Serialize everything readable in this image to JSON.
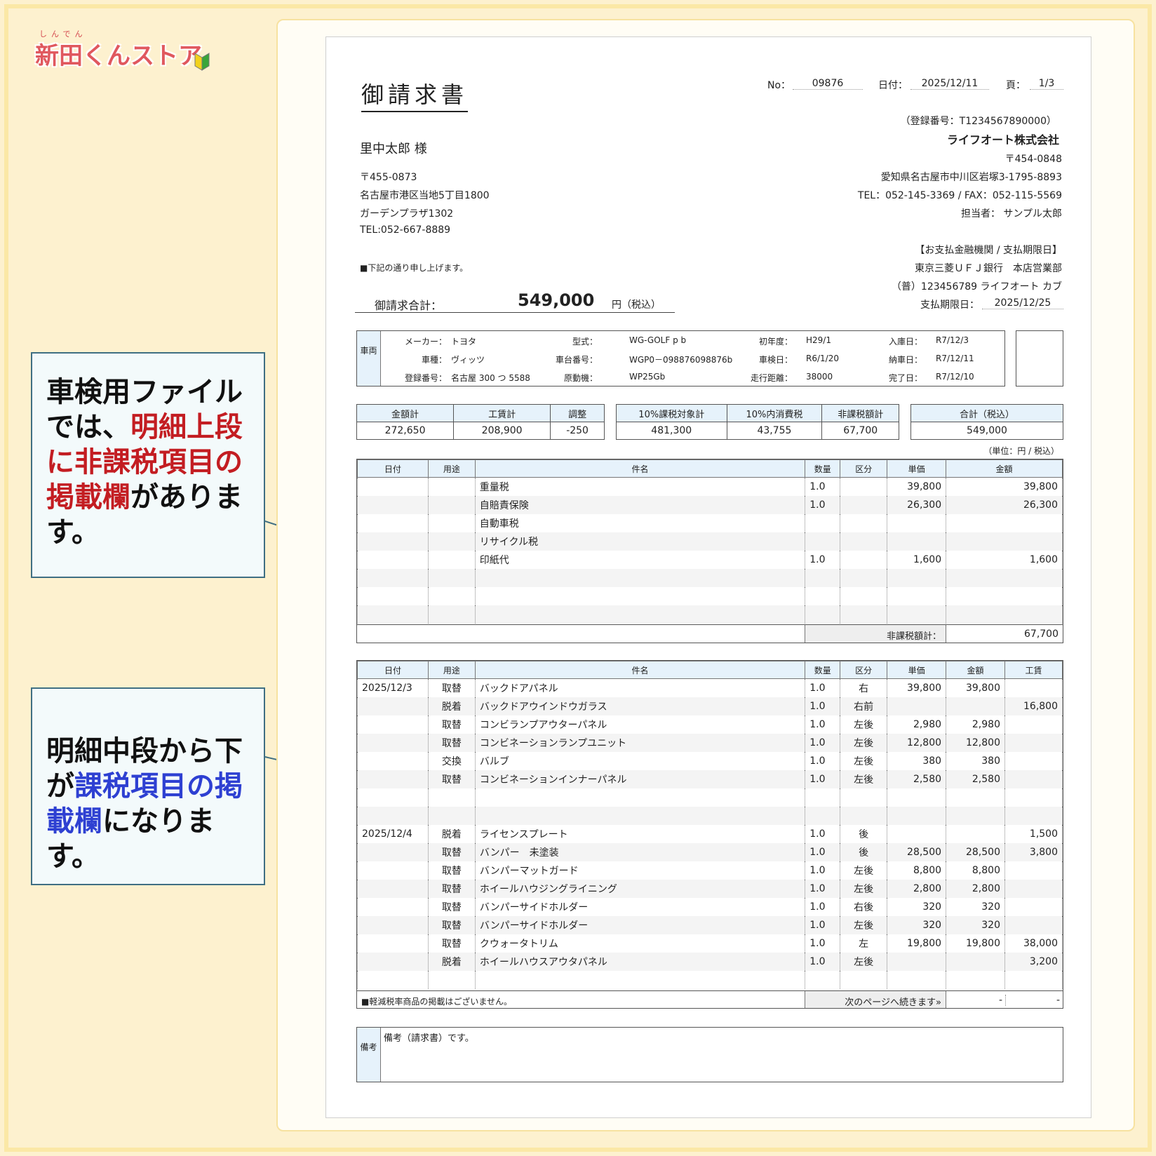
{
  "logo": {
    "ruby": "しんでん",
    "text": "新田くんストア"
  },
  "callouts": {
    "top": {
      "pre": "車検用ファイルでは、",
      "hl": "明細上段に非課税項目の掲載欄",
      "post": "があります。"
    },
    "bottom": {
      "pre": "明細中段から下が",
      "hl": "課税項目の掲載欄",
      "post": "になります。"
    }
  },
  "invoice": {
    "title": "御請求書",
    "no_label": "No：",
    "no": "09876",
    "date_label": "日付：",
    "date": "2025/12/11",
    "page_label": "頁：",
    "page": "1/3",
    "customer": {
      "name": "里中太郎 様",
      "zip": "〒455-0873",
      "addr1": "名古屋市港区当地5丁目1800",
      "addr2": "ガーデンプラザ1302",
      "tel": "TEL:052-667-8889"
    },
    "note": "■下記の通り申し上げます。",
    "total_label": "御請求合計：",
    "total": "549,000",
    "total_unit": "円（税込）",
    "issuer": {
      "reg": "（登録番号：T1234567890000）",
      "company": "ライフオート株式会社",
      "zip": "〒454-0848",
      "addr": "愛知県名古屋市中川区岩塚3-1795-8893",
      "telfax": "TEL：052-145-3369 / FAX：052-115-5569",
      "staff": "担当者：  サンプル太郎",
      "bank_title": "【お支払金融機関 / 支払期限日】",
      "bank": "東京三菱ＵＦＪ銀行　本店営業部",
      "account": "（普）123456789  ライフオート  カブ",
      "due_label": "支払期限日：",
      "due": "2025/12/25"
    },
    "vehicle": {
      "side": "車両",
      "fields": [
        {
          "label": "メーカー：",
          "value": "トヨタ"
        },
        {
          "label": "車種：",
          "value": "ヴィッツ"
        },
        {
          "label": "登録番号：",
          "value": "名古屋 300 つ 5588"
        },
        {
          "label": "型式：",
          "value": "WG-GOLF p b"
        },
        {
          "label": "車台番号：",
          "value": "WGP0－098876098876b"
        },
        {
          "label": "原動機：",
          "value": "WP25Gb"
        },
        {
          "label": "初年度：",
          "value": "H29/1"
        },
        {
          "label": "車検日：",
          "value": "R6/1/20"
        },
        {
          "label": "走行距離：",
          "value": "38000"
        },
        {
          "label": "入庫日：",
          "value": "R7/12/3"
        },
        {
          "label": "納車日：",
          "value": "R7/12/11"
        },
        {
          "label": "完了日：",
          "value": "R7/12/10"
        }
      ]
    },
    "summary": {
      "g1": [
        {
          "h": "金額計",
          "v": "272,650"
        },
        {
          "h": "工賃計",
          "v": "208,900"
        },
        {
          "h": "調整",
          "v": "-250"
        }
      ],
      "g2": [
        {
          "h": "10%課税対象計",
          "v": "481,300"
        },
        {
          "h": "10%内消費税",
          "v": "43,755"
        },
        {
          "h": "非課税額計",
          "v": "67,700"
        }
      ],
      "g3": [
        {
          "h": "合計（税込）",
          "v": "549,000"
        }
      ],
      "unit": "（単位：円 / 税込）"
    },
    "nontax": {
      "headers": [
        "日付",
        "用途",
        "件名",
        "数量",
        "区分",
        "単価",
        "金額"
      ],
      "rows": [
        [
          "",
          "",
          "重量税",
          "1.0",
          "",
          "39,800",
          "39,800"
        ],
        [
          "",
          "",
          "自賠責保険",
          "1.0",
          "",
          "26,300",
          "26,300"
        ],
        [
          "",
          "",
          "自動車税",
          "",
          "",
          "",
          ""
        ],
        [
          "",
          "",
          "リサイクル税",
          "",
          "",
          "",
          ""
        ],
        [
          "",
          "",
          "印紙代",
          "1.0",
          "",
          "1,600",
          "1,600"
        ],
        [
          "",
          "",
          "",
          "",
          "",
          "",
          ""
        ],
        [
          "",
          "",
          "",
          "",
          "",
          "",
          ""
        ],
        [
          "",
          "",
          "",
          "",
          "",
          "",
          ""
        ]
      ],
      "total_label": "非課税額計：",
      "total": "67,700"
    },
    "taxed": {
      "headers": [
        "日付",
        "用途",
        "件名",
        "数量",
        "区分",
        "単価",
        "金額",
        "工賃"
      ],
      "rows": [
        [
          "2025/12/3",
          "取替",
          "バックドアパネル",
          "1.0",
          "右",
          "39,800",
          "39,800",
          ""
        ],
        [
          "",
          "脱着",
          "バックドアウインドウガラス",
          "1.0",
          "右前",
          "",
          "",
          "16,800"
        ],
        [
          "",
          "取替",
          "コンビランプアウターパネル",
          "1.0",
          "左後",
          "2,980",
          "2,980",
          ""
        ],
        [
          "",
          "取替",
          "コンビネーションランプユニット",
          "1.0",
          "左後",
          "12,800",
          "12,800",
          ""
        ],
        [
          "",
          "交換",
          "バルブ",
          "1.0",
          "左後",
          "380",
          "380",
          ""
        ],
        [
          "",
          "取替",
          "コンビネーションインナーパネル",
          "1.0",
          "左後",
          "2,580",
          "2,580",
          ""
        ],
        [
          "",
          "",
          "",
          "",
          "",
          "",
          "",
          ""
        ],
        [
          "",
          "",
          "",
          "",
          "",
          "",
          "",
          ""
        ],
        [
          "2025/12/4",
          "脱着",
          "ライセンスプレート",
          "1.0",
          "後",
          "",
          "",
          "1,500"
        ],
        [
          "",
          "取替",
          "バンパー　未塗装",
          "1.0",
          "後",
          "28,500",
          "28,500",
          "3,800"
        ],
        [
          "",
          "取替",
          "バンパーマットガード",
          "1.0",
          "左後",
          "8,800",
          "8,800",
          ""
        ],
        [
          "",
          "取替",
          "ホイールハウジングライニング",
          "1.0",
          "左後",
          "2,800",
          "2,800",
          ""
        ],
        [
          "",
          "取替",
          "バンパーサイドホルダー",
          "1.0",
          "右後",
          "320",
          "320",
          ""
        ],
        [
          "",
          "取替",
          "バンパーサイドホルダー",
          "1.0",
          "左後",
          "320",
          "320",
          ""
        ],
        [
          "",
          "取替",
          "クウォータトリム",
          "1.0",
          "左",
          "19,800",
          "19,800",
          "38,000"
        ],
        [
          "",
          "脱着",
          "ホイールハウスアウタパネル",
          "1.0",
          "左後",
          "",
          "",
          "3,200"
        ],
        [
          "",
          "",
          "",
          "",
          "",
          "",
          "",
          ""
        ]
      ],
      "footer_note": "■軽減税率商品の掲載はございません。",
      "footer_next": "次のページへ続きます»",
      "footer_v1": "-",
      "footer_v2": "-"
    },
    "remarks": {
      "side": "備考",
      "text": "備考（請求書）です。"
    }
  }
}
